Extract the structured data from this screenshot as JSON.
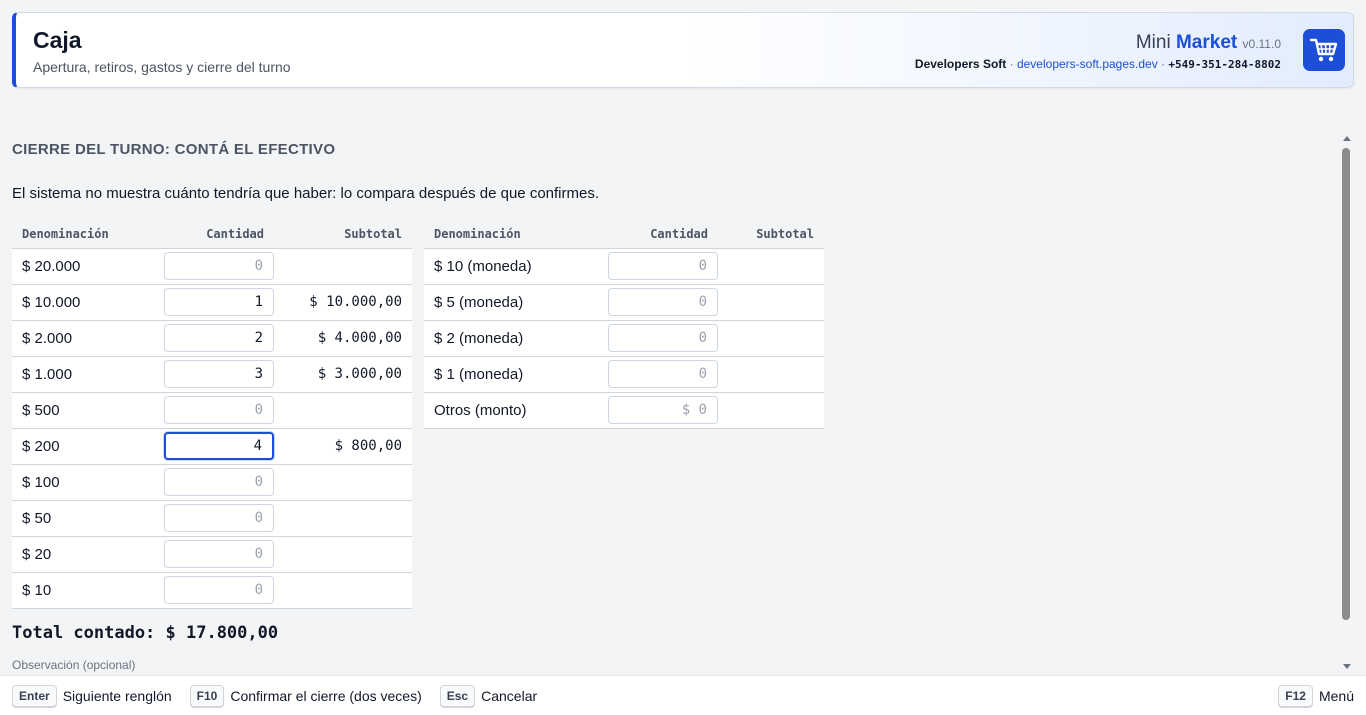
{
  "header": {
    "title": "Caja",
    "subtitle": "Apertura, retiros, gastos y cierre del turno",
    "brand_prefix": "Mini",
    "brand_name": "Market",
    "version": "v0.11.0",
    "company": "Developers Soft",
    "separator": "·",
    "url": "developers-soft.pages.dev",
    "phone": "+549-351-284-8802",
    "cart_icon": "shopping-cart-icon",
    "accent_color": "#1d4ed8"
  },
  "section": {
    "title": "CIERRE DEL TURNO: CONTÁ EL EFECTIVO",
    "description": "El sistema no muestra cuánto tendría que haber: lo compara después de que confirmes."
  },
  "columns": {
    "denomination": "Denominación",
    "quantity": "Cantidad",
    "subtotal": "Subtotal"
  },
  "bills": [
    {
      "label": "$ 20.000",
      "quantity": "",
      "placeholder": "0",
      "subtotal": ""
    },
    {
      "label": "$ 10.000",
      "quantity": "1",
      "placeholder": "0",
      "subtotal": "$ 10.000,00"
    },
    {
      "label": "$ 2.000",
      "quantity": "2",
      "placeholder": "0",
      "subtotal": "$ 4.000,00"
    },
    {
      "label": "$ 1.000",
      "quantity": "3",
      "placeholder": "0",
      "subtotal": "$ 3.000,00"
    },
    {
      "label": "$ 500",
      "quantity": "",
      "placeholder": "0",
      "subtotal": ""
    },
    {
      "label": "$ 200",
      "quantity": "4",
      "placeholder": "0",
      "subtotal": "$ 800,00",
      "focused": true
    },
    {
      "label": "$ 100",
      "quantity": "",
      "placeholder": "0",
      "subtotal": ""
    },
    {
      "label": "$ 50",
      "quantity": "",
      "placeholder": "0",
      "subtotal": ""
    },
    {
      "label": "$ 20",
      "quantity": "",
      "placeholder": "0",
      "subtotal": ""
    },
    {
      "label": "$ 10",
      "quantity": "",
      "placeholder": "0",
      "subtotal": ""
    }
  ],
  "coins": [
    {
      "label": "$ 10 (moneda)",
      "quantity": "",
      "placeholder": "0",
      "subtotal": ""
    },
    {
      "label": "$ 5 (moneda)",
      "quantity": "",
      "placeholder": "0",
      "subtotal": ""
    },
    {
      "label": "$ 2 (moneda)",
      "quantity": "",
      "placeholder": "0",
      "subtotal": ""
    },
    {
      "label": "$ 1 (moneda)",
      "quantity": "",
      "placeholder": "0",
      "subtotal": ""
    },
    {
      "label": "Otros (monto)",
      "quantity": "",
      "placeholder": "$ 0",
      "subtotal": ""
    }
  ],
  "total": "Total contado: $ 17.800,00",
  "observation_label": "Observación (opcional)",
  "footer": {
    "hints": [
      {
        "key": "Enter",
        "label": "Siguiente renglón"
      },
      {
        "key": "F10",
        "label": "Confirmar el cierre (dos veces)"
      },
      {
        "key": "Esc",
        "label": "Cancelar"
      }
    ],
    "menu": {
      "key": "F12",
      "label": "Menú"
    }
  }
}
